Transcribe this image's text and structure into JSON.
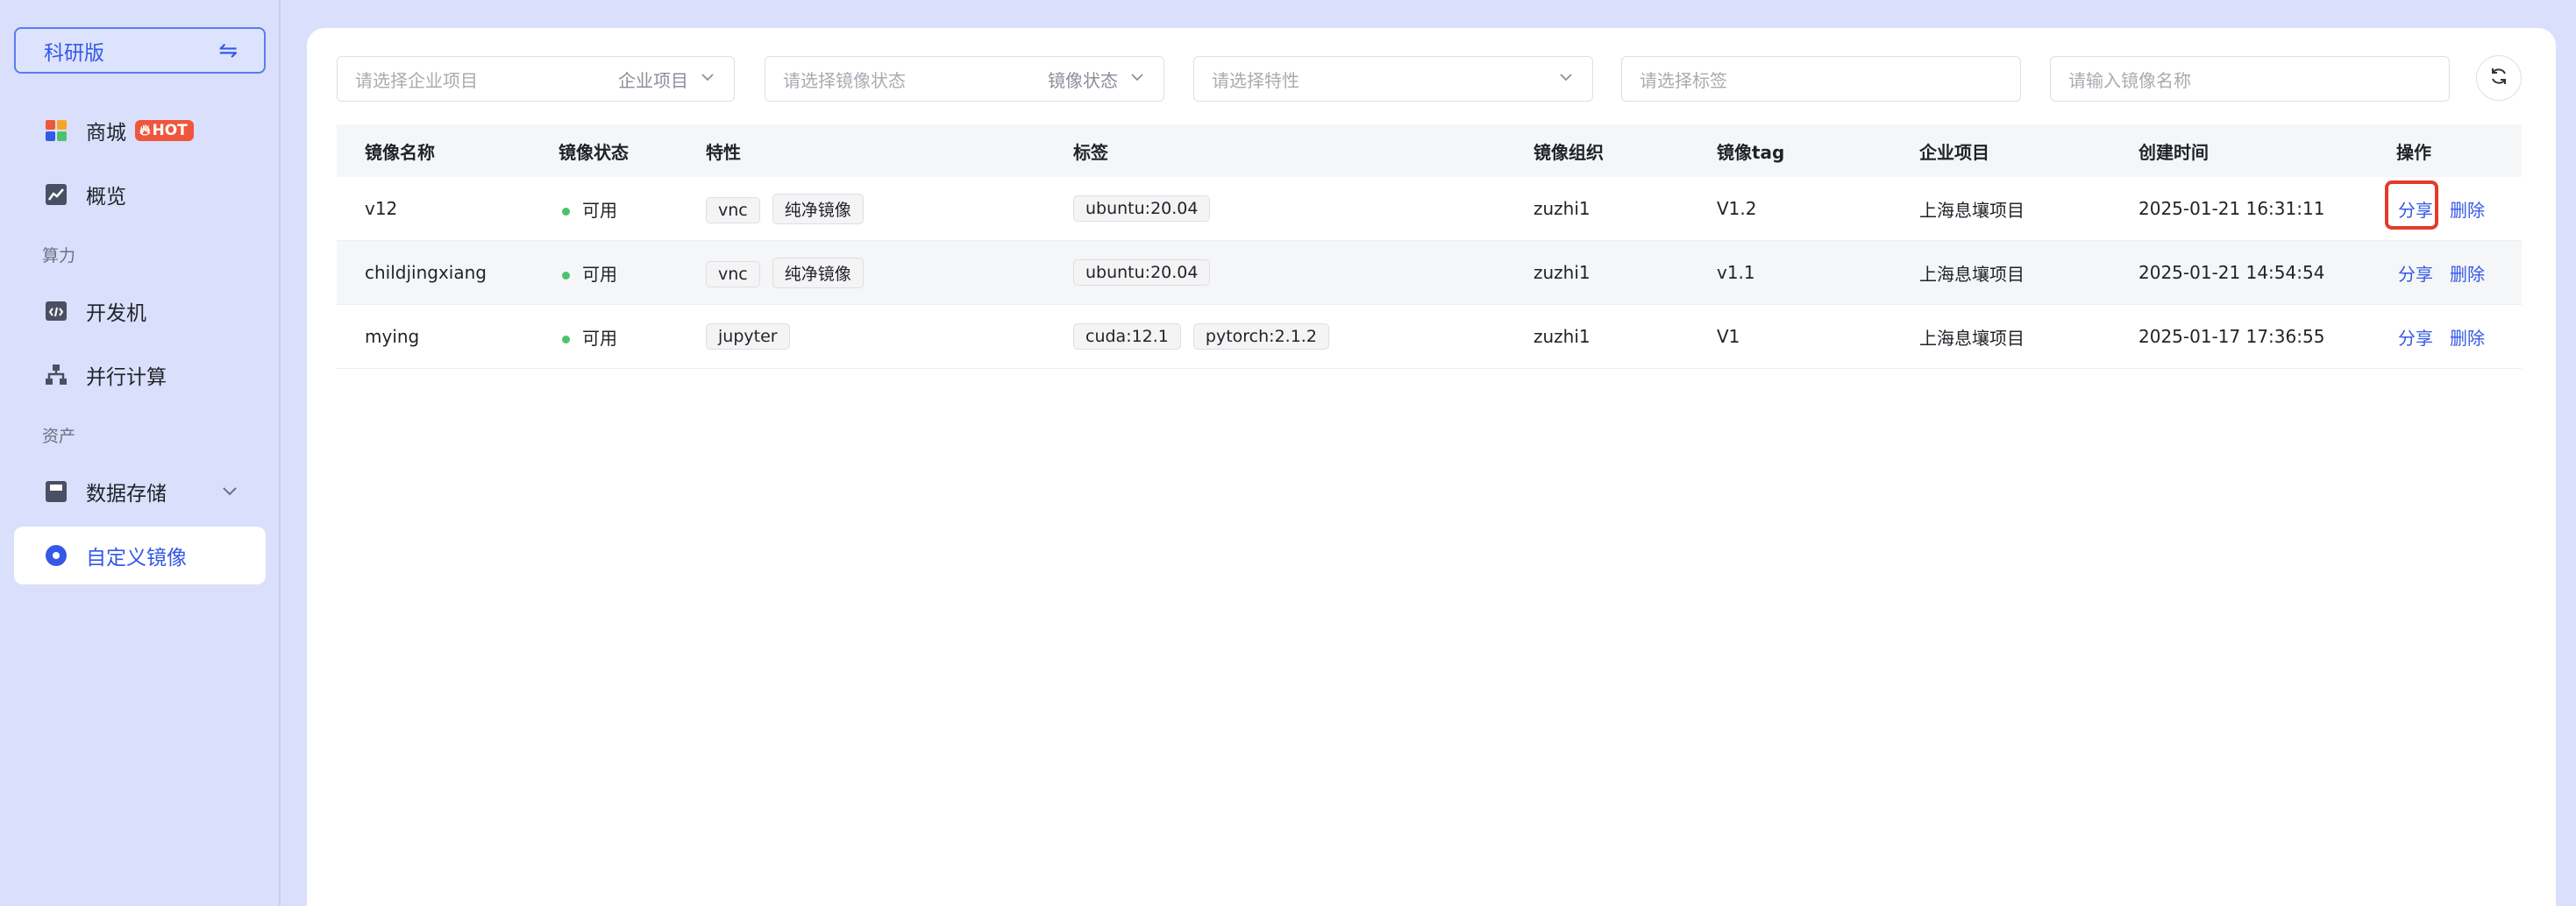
{
  "sidebar": {
    "edition_label": "科研版",
    "swap_icon": "swap-arrows-icon",
    "items": [
      {
        "label": "商城",
        "badge": "HOT",
        "icon": "store-grid-icon"
      },
      {
        "label": "概览",
        "icon": "chart-line-icon"
      },
      {
        "label": "开发机",
        "icon": "code-window-icon"
      },
      {
        "label": "并行计算",
        "icon": "hierarchy-icon"
      },
      {
        "label": "数据存储",
        "icon": "storage-disk-icon"
      },
      {
        "label": "自定义镜像",
        "icon": "disc-icon"
      }
    ],
    "sections": {
      "compute": "算力",
      "assets": "资产"
    }
  },
  "filters": {
    "project": {
      "placeholder": "请选择企业项目",
      "tail": "企业项目"
    },
    "status": {
      "placeholder": "请选择镜像状态",
      "tail": "镜像状态"
    },
    "feature": {
      "placeholder": "请选择特性"
    },
    "tag": {
      "placeholder": "请选择标签"
    },
    "name": {
      "placeholder": "请输入镜像名称"
    }
  },
  "table": {
    "headers": [
      "镜像名称",
      "镜像状态",
      "特性",
      "标签",
      "镜像组织",
      "镜像tag",
      "企业项目",
      "创建时间",
      "操作"
    ],
    "rows": [
      {
        "name": "v12",
        "status": "可用",
        "features": [
          "vnc",
          "纯净镜像"
        ],
        "tags": [
          "ubuntu:20.04"
        ],
        "org": "zuzhi1",
        "tag": "V1.2",
        "project": "上海息壤项目",
        "created": "2025-01-21 16:31:11",
        "share": "分享",
        "delete": "删除"
      },
      {
        "name": "childjingxiang",
        "status": "可用",
        "features": [
          "vnc",
          "纯净镜像"
        ],
        "tags": [
          "ubuntu:20.04"
        ],
        "org": "zuzhi1",
        "tag": "v1.1",
        "project": "上海息壤项目",
        "created": "2025-01-21 14:54:54",
        "share": "分享",
        "delete": "删除"
      },
      {
        "name": "mying",
        "status": "可用",
        "features": [
          "jupyter"
        ],
        "tags": [
          "cuda:12.1",
          "pytorch:2.1.2"
        ],
        "org": "zuzhi1",
        "tag": "V1",
        "project": "上海息壤项目",
        "created": "2025-01-17 17:36:55",
        "share": "分享",
        "delete": "删除"
      }
    ]
  },
  "colors": {
    "accent": "#3558e6",
    "hot": "#f0563c",
    "status_ok": "#4cc36b",
    "highlight": "#e23b2c"
  }
}
